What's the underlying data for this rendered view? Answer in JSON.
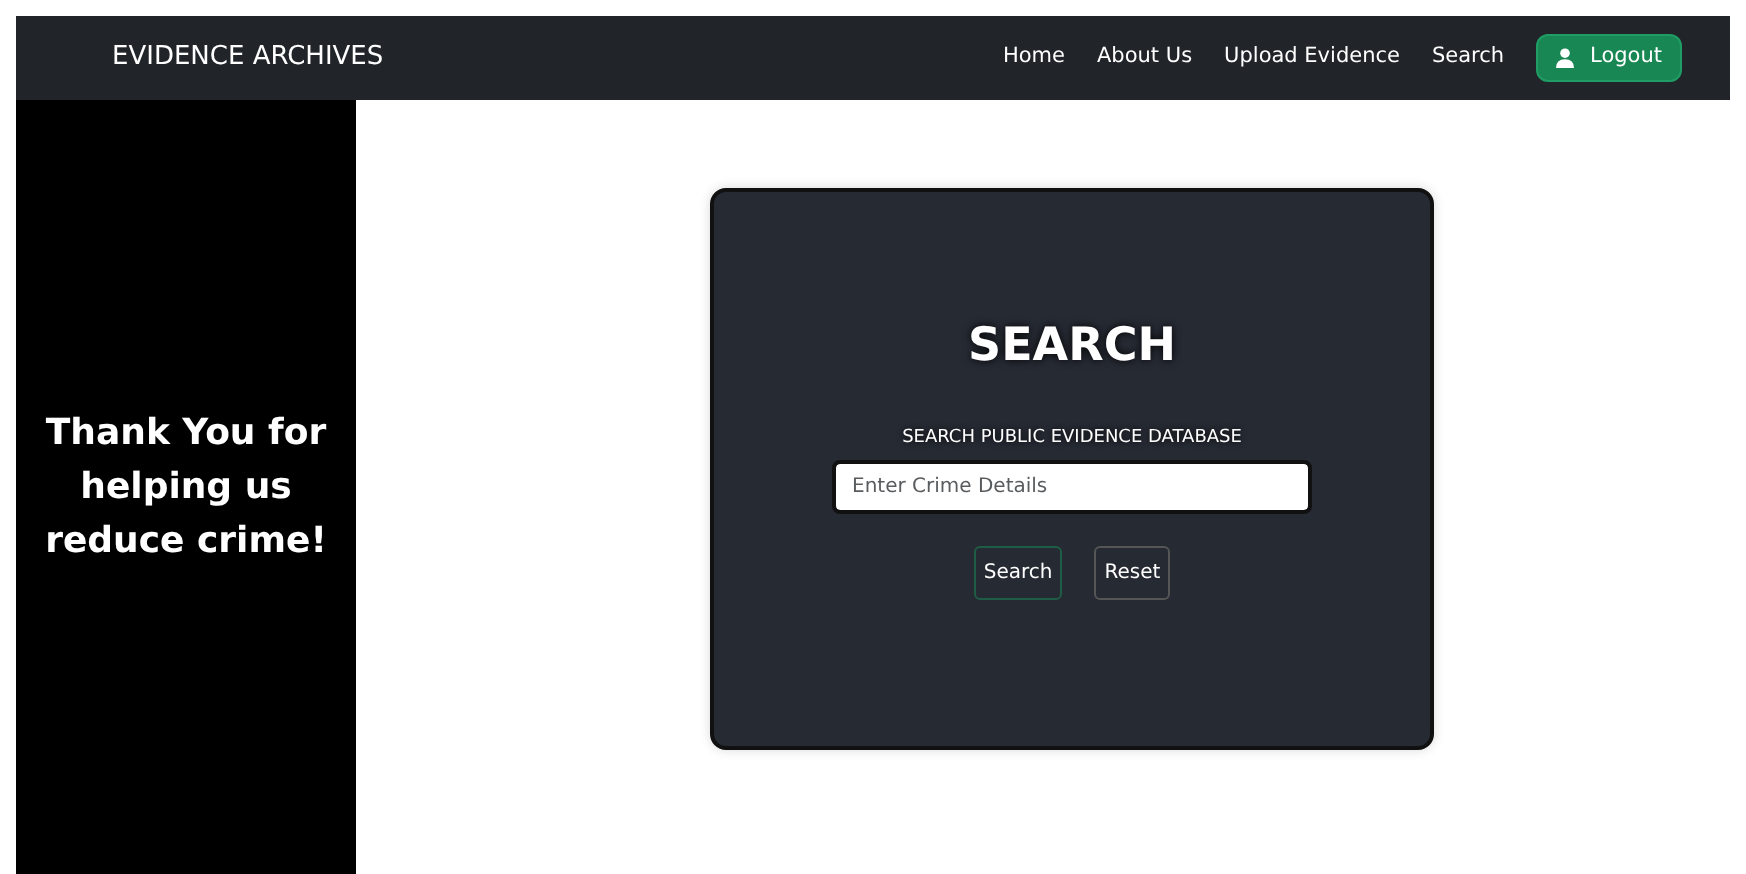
{
  "navbar": {
    "brand": "EVIDENCE ARCHIVES",
    "links": [
      "Home",
      "About Us",
      "Upload Evidence",
      "Search"
    ],
    "logout_button": "Logout"
  },
  "sidebar": {
    "message": "Thank You for helping us reduce crime!"
  },
  "search_card": {
    "title": "SEARCH",
    "label": "SEARCH PUBLIC EVIDENCE DATABASE",
    "field": {
      "placeholder": "Enter Crime Details"
    },
    "buttons": [
      {
        "label": "Search",
        "kind": "submit"
      },
      {
        "label": "Reset",
        "kind": "reset"
      }
    ]
  }
}
